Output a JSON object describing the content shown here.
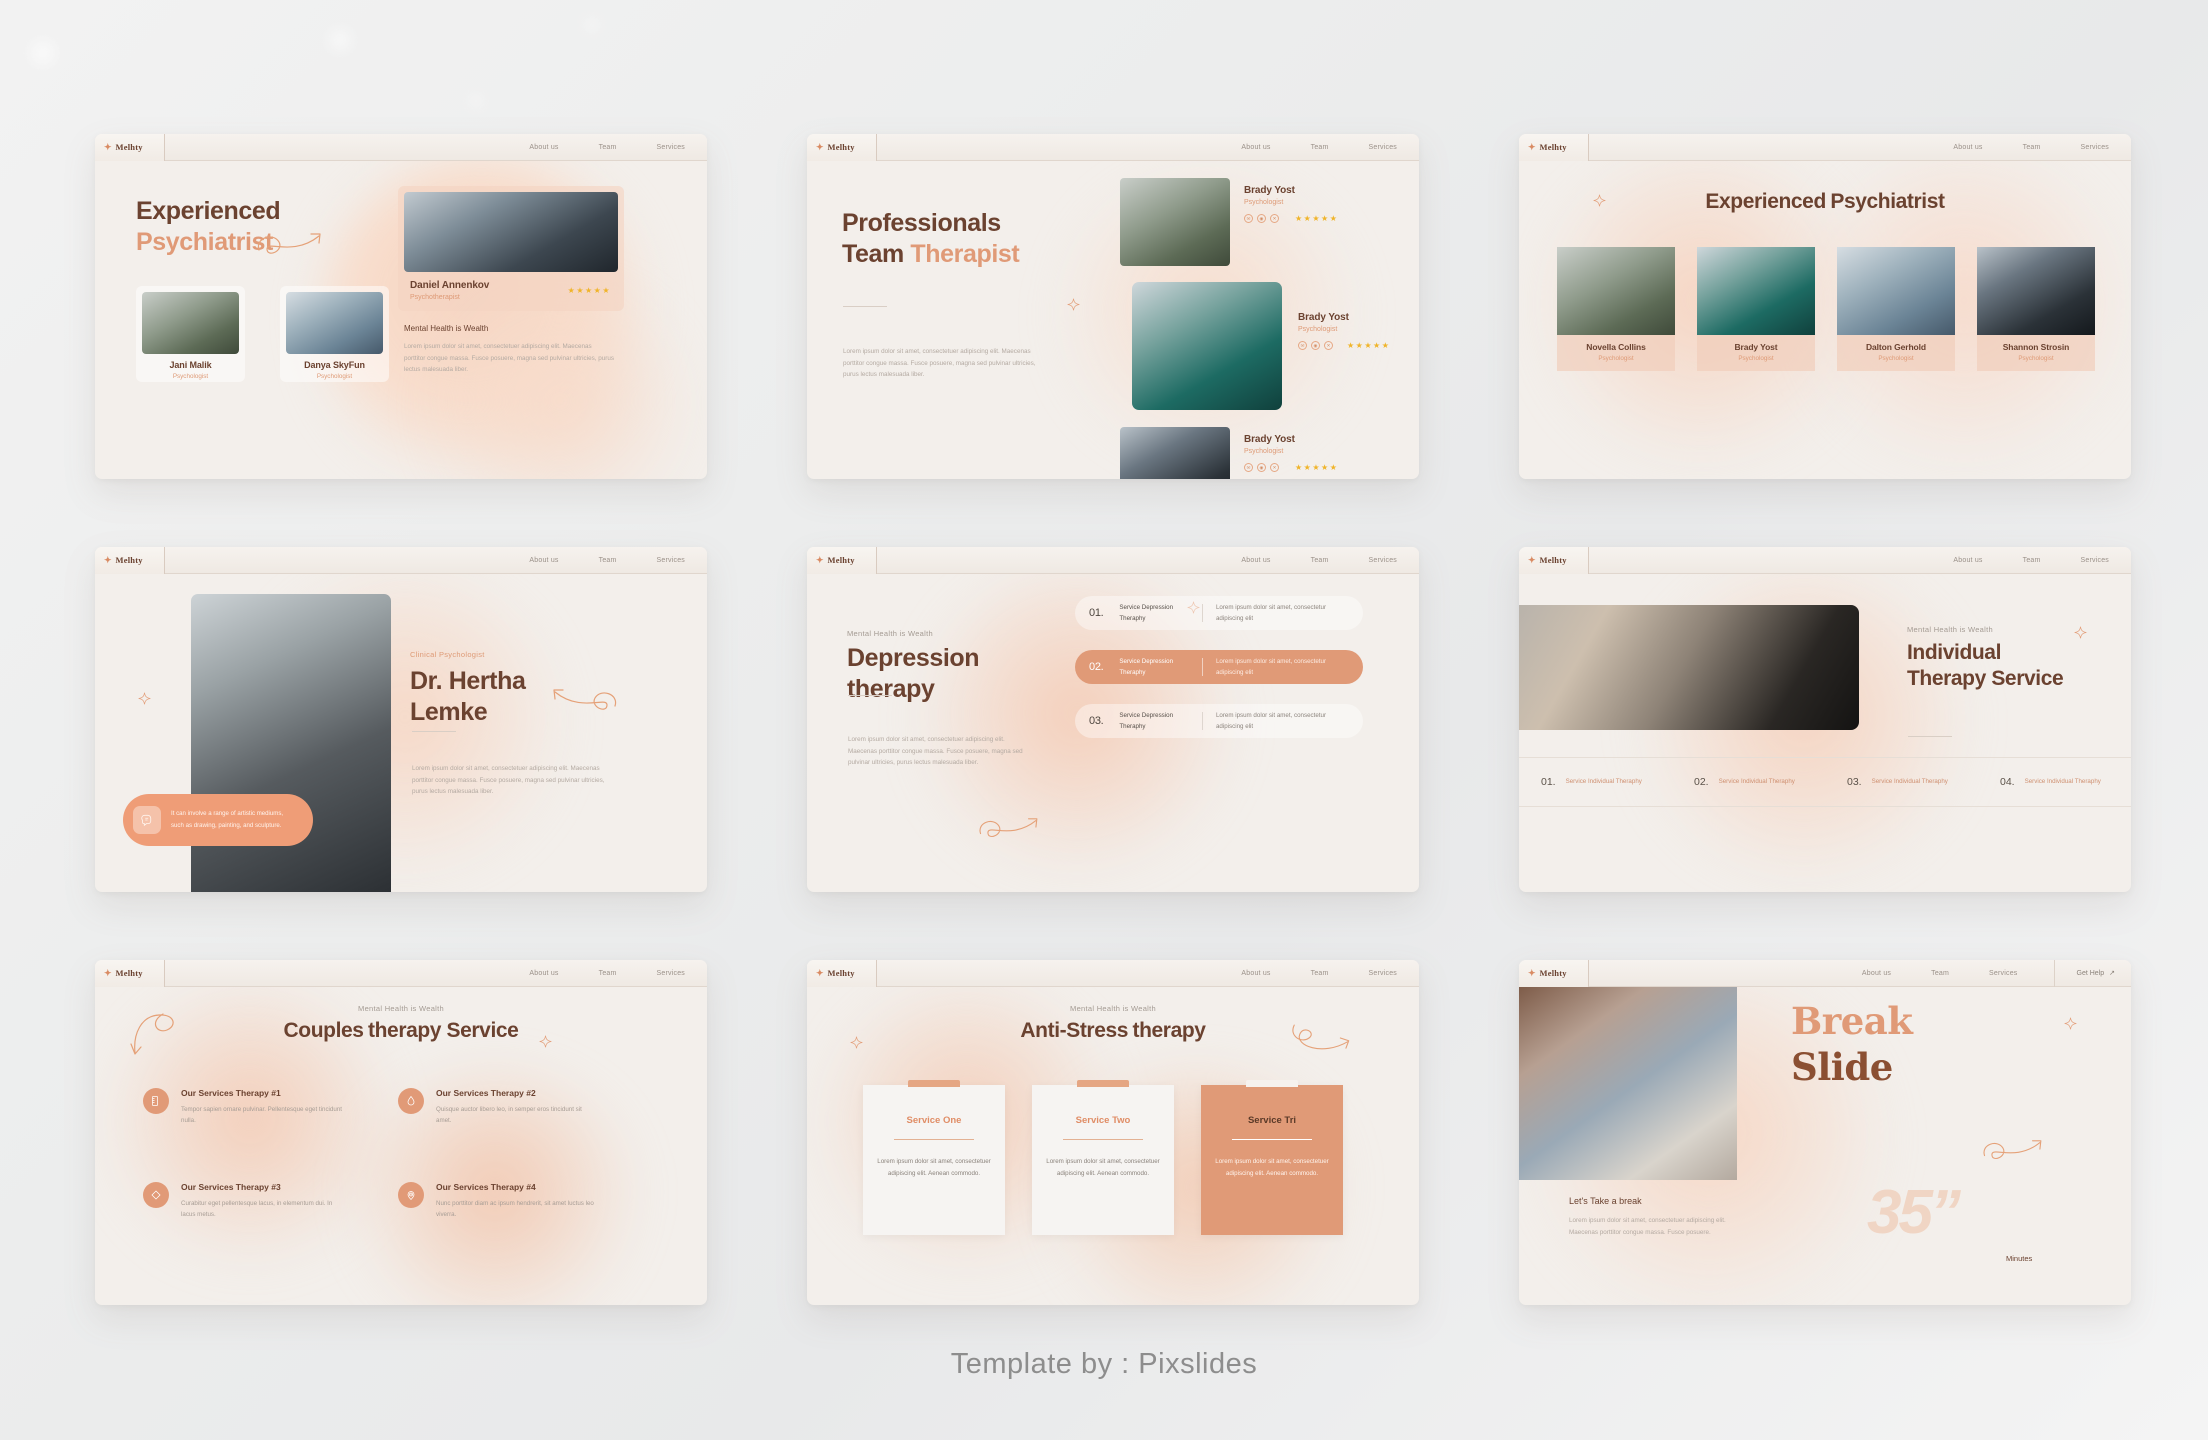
{
  "footer": {
    "credit": "Template by : Pixslides"
  },
  "colors": {
    "accent": "#e09a77",
    "dark_brown": "#6b4230",
    "light_peach": "#f0d5c4",
    "slide_bg": "#f3efeb",
    "star_gold": "#f0b429",
    "muted_text": "#a79d95"
  },
  "nav": {
    "brand": "Melhty",
    "brand_icon": "plus-icon",
    "links": [
      "About us",
      "Team",
      "Services"
    ],
    "cta": {
      "label": "Get Help",
      "icon": "arrow-up-right-icon"
    }
  },
  "common": {
    "eyebrow": "Mental Health is Wealth",
    "lorem_short": "Lorem ipsum dolor sit amet, consectetuer adipiscing elit. Maecenas porttitor congue massa. Fusce posuere, magna sed pulvinar ultricies, purus lectus malesuada liber.",
    "lorem_cell": "Lorem ipsum dolor sit amet, consectetur  adipiscing elit",
    "stars": "★★★★★"
  },
  "slides": [
    {
      "id": "slide-experienced-psychiatrist",
      "title_dark": "Experienced",
      "title_light": "Psychiatrist",
      "featured": {
        "name": "Daniel Annenkov",
        "role": "Psychotherapist",
        "rating": "★★★★★",
        "photo": "daniel-annenkov-photo"
      },
      "section_label": "Mental Health is Wealth",
      "paragraph": "Lorem ipsum dolor sit amet, consectetuer adipiscing elit. Maecenas porttitor congue massa. Fusce posuere, magna sed pulvinar ultricies, purus lectus malesuada liber.",
      "people": [
        {
          "name": "Jani Malik",
          "role": "Psychologist",
          "photo": "jani-malik-photo"
        },
        {
          "name": "Danya SkyFun",
          "role": "Psychologist",
          "photo": "danya-skyfun-photo"
        }
      ]
    },
    {
      "id": "slide-professionals-team",
      "title_dark_1": "Professionals",
      "title_dark_2": "Team",
      "title_light": "Therapist",
      "paragraph": "Lorem ipsum dolor sit amet, consectetuer adipiscing elit. Maecenas porttitor congue massa. Fusce posuere, magna sed pulvinar ultricies, purus lectus malesuada liber.",
      "members": [
        {
          "name": "Brady Yost",
          "role": "Psychologist",
          "rating": "★★★★★",
          "photo": "member-1-photo"
        },
        {
          "name": "Brady Yost",
          "role": "Psychologist",
          "rating": "★★★★★",
          "photo": "member-2-photo"
        },
        {
          "name": "Brady Yost",
          "role": "Psychologist",
          "rating": "★★★★★",
          "photo": "member-3-photo"
        }
      ],
      "social_icons": [
        "mail-icon",
        "instagram-icon",
        "twitter-icon"
      ]
    },
    {
      "id": "slide-experienced-psychiatrist-grid",
      "title_dark": "Experienced",
      "title_light": "Psychiatrist",
      "people": [
        {
          "name": "Novella Collins",
          "role": "Psychologist",
          "photo": "novella-collins-photo"
        },
        {
          "name": "Brady Yost",
          "role": "Psychologist",
          "photo": "brady-yost-photo"
        },
        {
          "name": "Dalton Gerhold",
          "role": "Psychologist",
          "photo": "dalton-gerhold-photo"
        },
        {
          "name": "Shannon Strosin",
          "role": "Psychologist",
          "photo": "shannon-strosin-photo"
        }
      ]
    },
    {
      "id": "slide-dr-hertha-lemke",
      "eyebrow": "Clinical Psychologist",
      "title_dark": "Dr. Hertha",
      "title_light": "Lemke",
      "paragraph": "Lorem ipsum dolor sit amet, consectetuer adipiscing elit. Maecenas porttitor congue massa. Fusce posuere, magna sed pulvinar ultricies, purus lectus malesuada liber.",
      "badge": {
        "icon": "brain-head-icon",
        "line1": "It can involve a range of artistic mediums,",
        "line2": "such as drawing, painting, and sculpture."
      },
      "photo": "dr-hertha-lemke-photo"
    },
    {
      "id": "slide-depression-therapy",
      "eyebrow": "Mental Health is Wealth",
      "title_dark": "Depression",
      "title_light": "therapy",
      "paragraph": "Lorem ipsum dolor sit amet, consectetuer adipiscing elit. Maecenas porttitor congue massa. Fusce posuere, magna sed pulvinar ultricies, purus lectus malesuada liber.",
      "rows": [
        {
          "num": "01.",
          "title": "Service Depression Theraphy",
          "desc": "Lorem ipsum dolor sit amet, consectetur  adipiscing elit",
          "active": false
        },
        {
          "num": "02.",
          "title": "Service Depression Theraphy",
          "desc": "Lorem ipsum dolor sit amet, consectetur  adipiscing elit",
          "active": true
        },
        {
          "num": "03.",
          "title": "Service Depression Theraphy",
          "desc": "Lorem ipsum dolor sit amet, consectetur  adipiscing elit",
          "active": false
        }
      ]
    },
    {
      "id": "slide-individual-therapy-service",
      "eyebrow": "Mental Health is Wealth",
      "title_dark": "Individual",
      "title_light": "Therapy Service",
      "photo": "individual-therapy-photo",
      "items": [
        {
          "num": "01.",
          "title": "Service Individual Theraphy"
        },
        {
          "num": "02.",
          "title": "Service Individual Theraphy"
        },
        {
          "num": "03.",
          "title": "Service Individual Theraphy"
        },
        {
          "num": "04.",
          "title": "Service Individual Theraphy"
        }
      ]
    },
    {
      "id": "slide-couples-therapy-service",
      "eyebrow": "Mental Health is Wealth",
      "title_dark": "Couples",
      "title_light": "therapy Service",
      "features": [
        {
          "icon": "ruler-icon",
          "title": "Our Services Therapy #1",
          "desc": "Tempor sapien ornare pulvinar. Pellentesque eget tincidunt nulla."
        },
        {
          "icon": "drop-icon",
          "title": "Our Services Therapy #2",
          "desc": "Quisque auctor libero leo, in semper eros tincidunt sit amet."
        },
        {
          "icon": "eraser-icon",
          "title": "Our Services Therapy #3",
          "desc": "Curabitur eget pellentesque lacus, in elementum dui. In lacus metus."
        },
        {
          "icon": "clock-pin-icon",
          "title": "Our Services Therapy #4",
          "desc": "Nunc porttitor diam ac ipsum hendrerit, sit amet luctus leo viverra."
        }
      ]
    },
    {
      "id": "slide-anti-stress-therapy",
      "eyebrow": "Mental Health is Wealth",
      "title_dark": "Anti-Stress",
      "title_light": "therapy",
      "cards": [
        {
          "title": "Service One",
          "desc": "Lorem ipsum dolor sit amet, consectetuer adipiscing elit. Aenean commodo.",
          "highlighted": false
        },
        {
          "title": "Service Two",
          "desc": "Lorem ipsum dolor sit amet, consectetuer adipiscing elit. Aenean commodo.",
          "highlighted": false
        },
        {
          "title": "Service Tri",
          "desc": "Lorem ipsum dolor sit amet, consectetuer adipiscing elit. Aenean commodo.",
          "highlighted": true
        }
      ]
    },
    {
      "id": "slide-break",
      "title_light": "Break",
      "title_dark": "Slide",
      "lead": "Let's Take a break",
      "paragraph": "Lorem ipsum dolor sit amet, consectetuer adipiscing elit. Maecenas porttitor congue massa. Fusce posuere.",
      "timer_value": "35”",
      "timer_unit": "Minutes",
      "photo": "break-slide-photo",
      "nav_cta": "Get Help"
    }
  ]
}
